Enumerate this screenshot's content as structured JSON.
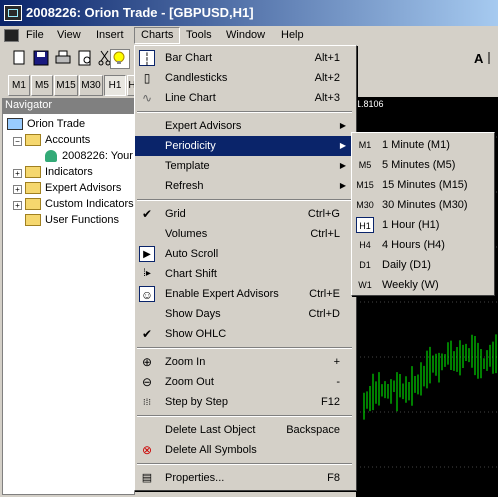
{
  "window": {
    "title": "2008226: Orion Trade - [GBPUSD,H1]"
  },
  "menubar": {
    "file": "File",
    "view": "View",
    "insert": "Insert",
    "charts": "Charts",
    "tools": "Tools",
    "window": "Window",
    "help": "Help"
  },
  "timeframes": [
    "M1",
    "M5",
    "M15",
    "M30",
    "H1",
    "H"
  ],
  "navigator": {
    "title": "Navigator",
    "root": "Orion Trade",
    "accounts": "Accounts",
    "account": "2008226: Your",
    "indicators": "Indicators",
    "experts": "Expert Advisors",
    "custom": "Custom Indicators",
    "functions": "User Functions"
  },
  "chart": {
    "price_label": "1.8106"
  },
  "charts_menu": {
    "bar_chart": {
      "label": "Bar Chart",
      "shortcut": "Alt+1"
    },
    "candlesticks": {
      "label": "Candlesticks",
      "shortcut": "Alt+2"
    },
    "line_chart": {
      "label": "Line Chart",
      "shortcut": "Alt+3"
    },
    "expert_advisors": {
      "label": "Expert Advisors"
    },
    "periodicity": {
      "label": "Periodicity"
    },
    "template": {
      "label": "Template"
    },
    "refresh": {
      "label": "Refresh"
    },
    "grid": {
      "label": "Grid",
      "shortcut": "Ctrl+G"
    },
    "volumes": {
      "label": "Volumes",
      "shortcut": "Ctrl+L"
    },
    "auto_scroll": {
      "label": "Auto Scroll"
    },
    "chart_shift": {
      "label": "Chart Shift"
    },
    "enable_experts": {
      "label": "Enable Expert Advisors",
      "shortcut": "Ctrl+E"
    },
    "show_days": {
      "label": "Show Days",
      "shortcut": "Ctrl+D"
    },
    "show_ohlc": {
      "label": "Show OHLC"
    },
    "zoom_in": {
      "label": "Zoom In",
      "shortcut": "+"
    },
    "zoom_out": {
      "label": "Zoom Out",
      "shortcut": "-"
    },
    "step": {
      "label": "Step by Step",
      "shortcut": "F12"
    },
    "delete_last": {
      "label": "Delete Last Object",
      "shortcut": "Backspace"
    },
    "delete_all": {
      "label": "Delete All Symbols"
    },
    "properties": {
      "label": "Properties...",
      "shortcut": "F8"
    }
  },
  "periodicity_menu": [
    {
      "code": "M1",
      "label": "1 Minute (M1)"
    },
    {
      "code": "M5",
      "label": "5 Minutes (M5)"
    },
    {
      "code": "M15",
      "label": "15 Minutes (M15)"
    },
    {
      "code": "M30",
      "label": "30 Minutes (M30)"
    },
    {
      "code": "H1",
      "label": "1 Hour (H1)"
    },
    {
      "code": "H4",
      "label": "4 Hours (H4)"
    },
    {
      "code": "D1",
      "label": "Daily (D1)"
    },
    {
      "code": "W1",
      "label": "Weekly (W)"
    }
  ],
  "colors": {
    "highlight": "#0a246a",
    "menu_bg": "#d4d0c8",
    "chart_bg": "#000000",
    "candles": "#00ff00"
  }
}
